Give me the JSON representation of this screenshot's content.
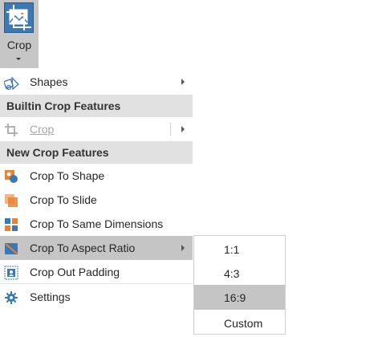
{
  "ribbon": {
    "crop_label": "Crop",
    "crop_icon": "crop-picture-icon",
    "dropdown_icon": "caret-down-icon"
  },
  "menu": {
    "shapes": {
      "label": "Shapes",
      "icon": "shapes-icon"
    },
    "builtin_header": "Builtin Crop Features",
    "builtin_crop": {
      "label": "Crop",
      "icon": "crop-icon",
      "disabled": true
    },
    "new_header": "New Crop Features",
    "crop_to_shape": {
      "label": "Crop To Shape",
      "icon": "crop-to-shape-icon"
    },
    "crop_to_slide": {
      "label": "Crop To Slide",
      "icon": "crop-to-slide-icon"
    },
    "crop_same_dimensions": {
      "label": "Crop To Same Dimensions",
      "icon": "same-dimensions-icon"
    },
    "crop_aspect_ratio": {
      "label": "Crop To Aspect Ratio",
      "icon": "aspect-ratio-icon",
      "highlighted": true
    },
    "crop_out_padding": {
      "label": "Crop Out Padding",
      "icon": "crop-padding-icon"
    },
    "settings": {
      "label": "Settings",
      "icon": "gear-icon"
    }
  },
  "aspect_submenu": {
    "items": [
      "1:1",
      "4:3",
      "16:9",
      "Custom"
    ],
    "selected": "16:9"
  },
  "colors": {
    "accent_blue": "#3c78b3",
    "orange": "#e8822e",
    "hover": "#c5c5c5",
    "header_bg": "#e1e1e1"
  }
}
